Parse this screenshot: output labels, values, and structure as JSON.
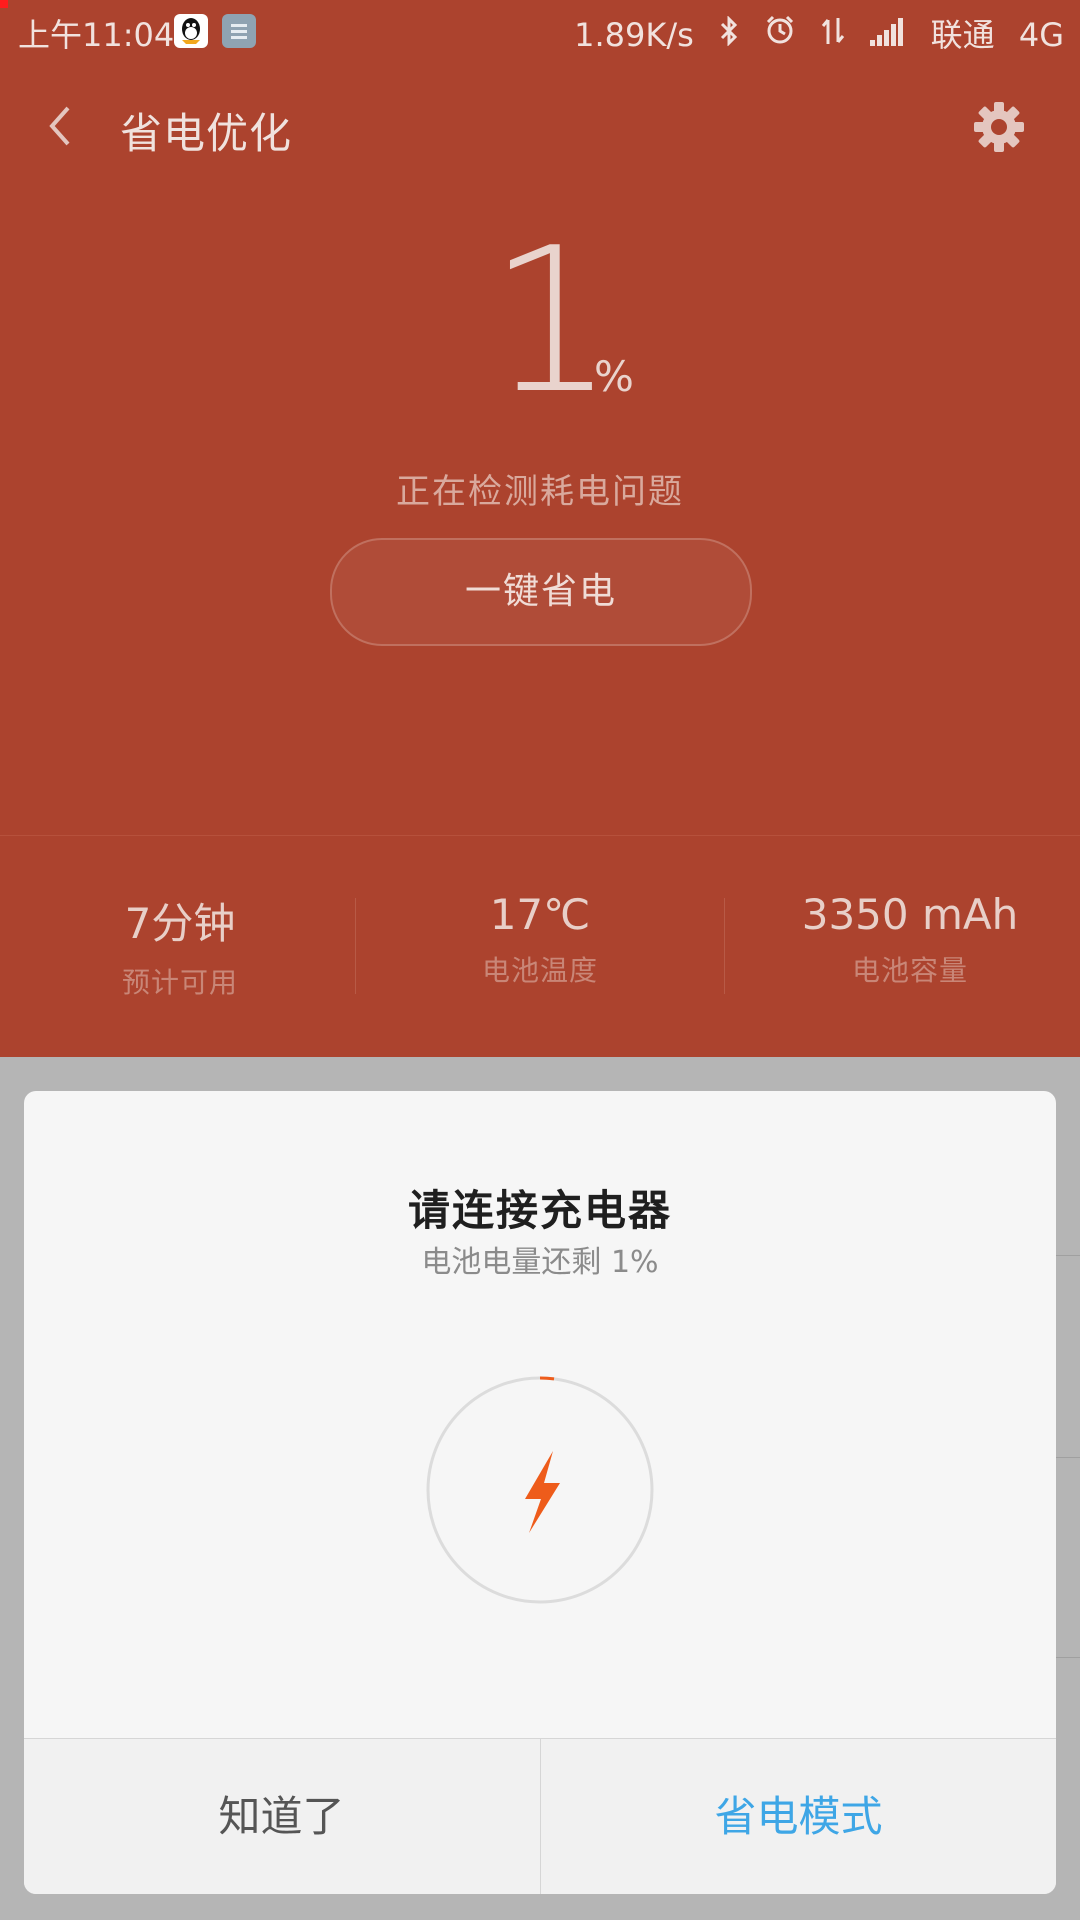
{
  "status_bar": {
    "time": "上午11:04",
    "net_speed": "1.89K/s",
    "carrier": "联通",
    "network": "4G"
  },
  "header": {
    "title": "省电优化"
  },
  "battery": {
    "level": "1",
    "unit": "%",
    "detect_text": "正在检测耗电问题",
    "one_key_button": "一键省电"
  },
  "stats": [
    {
      "value": "7分钟",
      "label": "预计可用"
    },
    {
      "value": "17℃",
      "label": "电池温度"
    },
    {
      "value": "3350 mAh",
      "label": "电池容量"
    }
  ],
  "dialog": {
    "title": "请连接充电器",
    "subtitle": "电池电量还剩 1%",
    "progress": 0.01,
    "ok_button": "知道了",
    "save_mode_button": "省电模式"
  },
  "colors": {
    "panel_red": "#ac432e",
    "accent_orange": "#ee5c1b",
    "accent_blue": "#3ea6e6"
  }
}
